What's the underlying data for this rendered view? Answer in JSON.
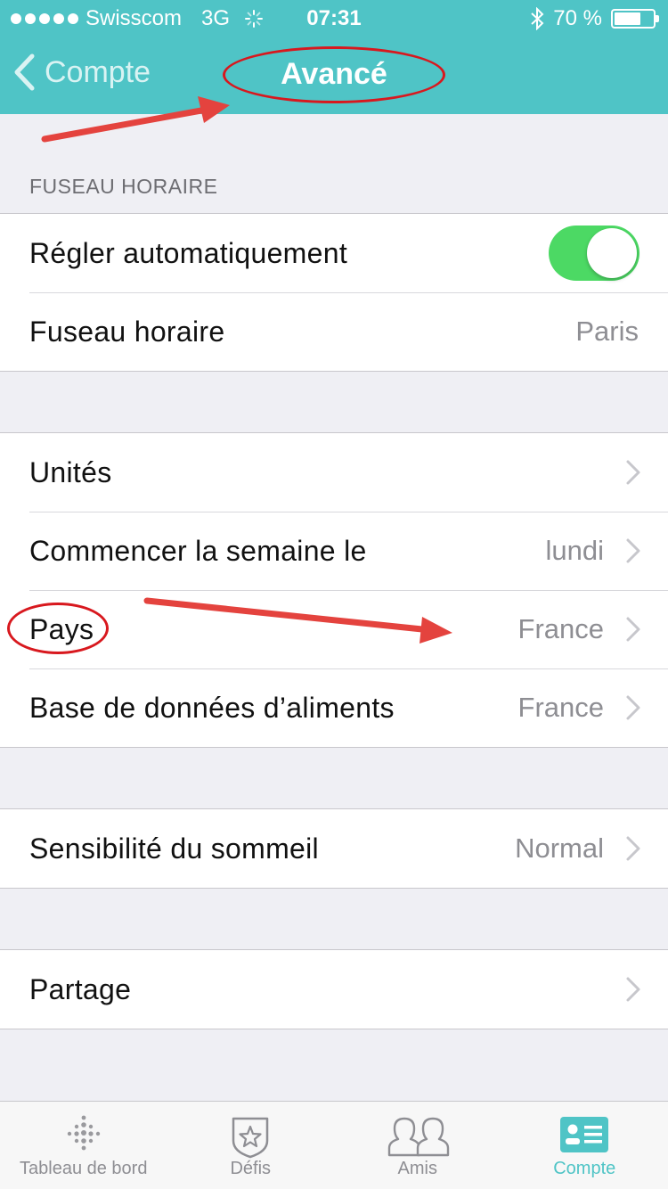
{
  "status_bar": {
    "carrier": "Swisscom",
    "network": "3G",
    "time": "07:31",
    "battery": "70 %",
    "battery_level": 0.7
  },
  "nav": {
    "back_label": "Compte",
    "title": "Avancé"
  },
  "timezone_section": {
    "header": "FUSEAU HORAIRE",
    "auto_label": "Régler automatiquement",
    "auto_enabled": true,
    "timezone_label": "Fuseau horaire",
    "timezone_value": "Paris"
  },
  "settings_group": {
    "items": [
      {
        "label": "Unités",
        "value": ""
      },
      {
        "label": "Commencer la semaine le",
        "value": "lundi"
      },
      {
        "label": "Pays",
        "value": "France"
      },
      {
        "label": "Base de données d’aliments",
        "value": "France"
      }
    ]
  },
  "sleep_group": {
    "label": "Sensibilité du sommeil",
    "value": "Normal"
  },
  "sharing_group": {
    "label": "Partage"
  },
  "tab_bar": {
    "tabs": [
      {
        "label": "Tableau de bord",
        "icon": "dashboard-dots-icon",
        "active": false
      },
      {
        "label": "Défis",
        "icon": "badge-star-icon",
        "active": false
      },
      {
        "label": "Amis",
        "icon": "friends-icon",
        "active": false
      },
      {
        "label": "Compte",
        "icon": "account-card-icon",
        "active": true
      }
    ]
  },
  "colors": {
    "brand": "#4fc4c6",
    "toggle_on": "#4cd964",
    "annotation": "#d8181e",
    "arrow": "#e4433e"
  }
}
